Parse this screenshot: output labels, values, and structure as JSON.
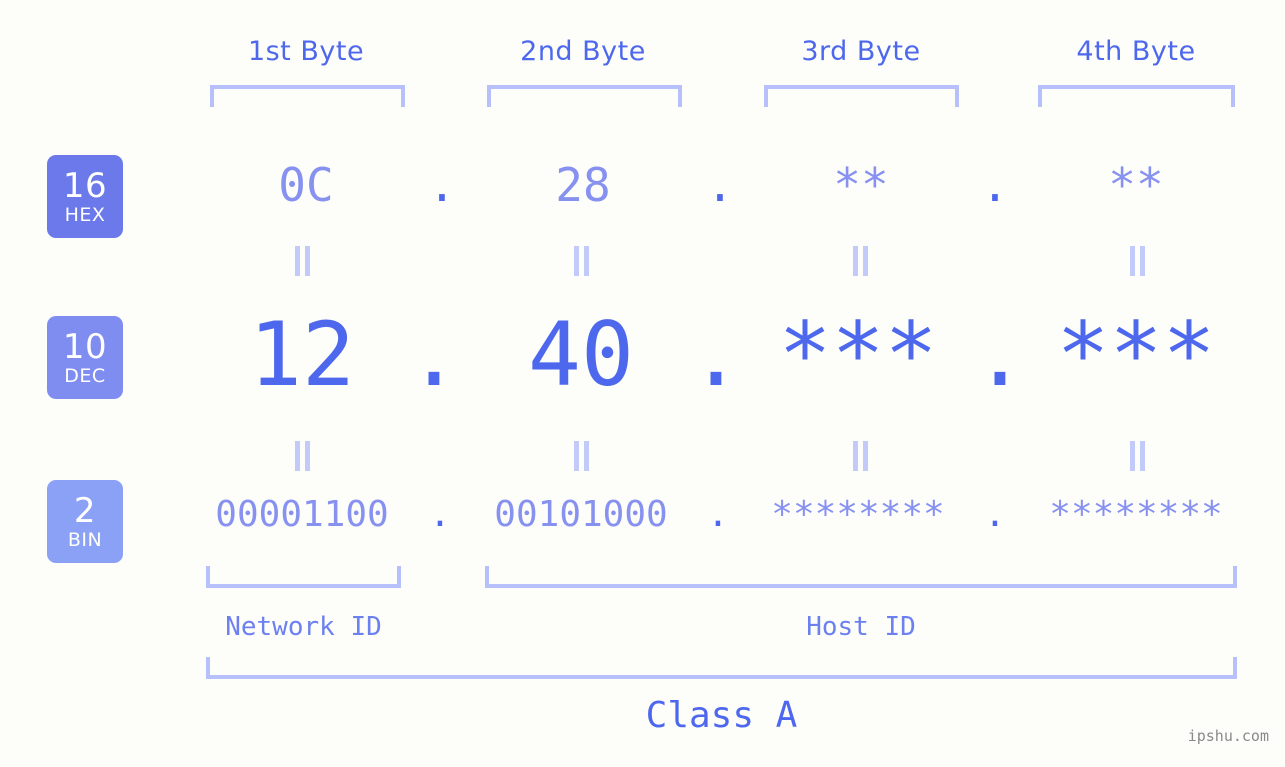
{
  "meta": {
    "watermark": "ipshu.com"
  },
  "byte_headers": [
    {
      "label": "1st Byte"
    },
    {
      "label": "2nd Byte"
    },
    {
      "label": "3rd Byte"
    },
    {
      "label": "4th Byte"
    }
  ],
  "rows": [
    {
      "badge_num": "16",
      "badge_sub": "HEX",
      "badge_color": "#6b79ea",
      "values": [
        "0C",
        "28",
        "**",
        "**"
      ],
      "separator": "."
    },
    {
      "badge_num": "10",
      "badge_sub": "DEC",
      "badge_color": "#7f8df1",
      "values": [
        "12",
        "40",
        "***",
        "***"
      ],
      "separator": "."
    },
    {
      "badge_num": "2",
      "badge_sub": "BIN",
      "badge_color": "#8ba1f6",
      "values": [
        "00001100",
        "00101000",
        "********",
        "********"
      ],
      "separator": "."
    }
  ],
  "zones": [
    {
      "label": "Network ID"
    },
    {
      "label": "Host ID"
    }
  ],
  "class": {
    "label": "Class A"
  },
  "colors": {
    "background": "#fdfdfa",
    "accent": "#4e68ed",
    "accent_light": "#8791f0",
    "bracket": "#b7c0fb"
  }
}
